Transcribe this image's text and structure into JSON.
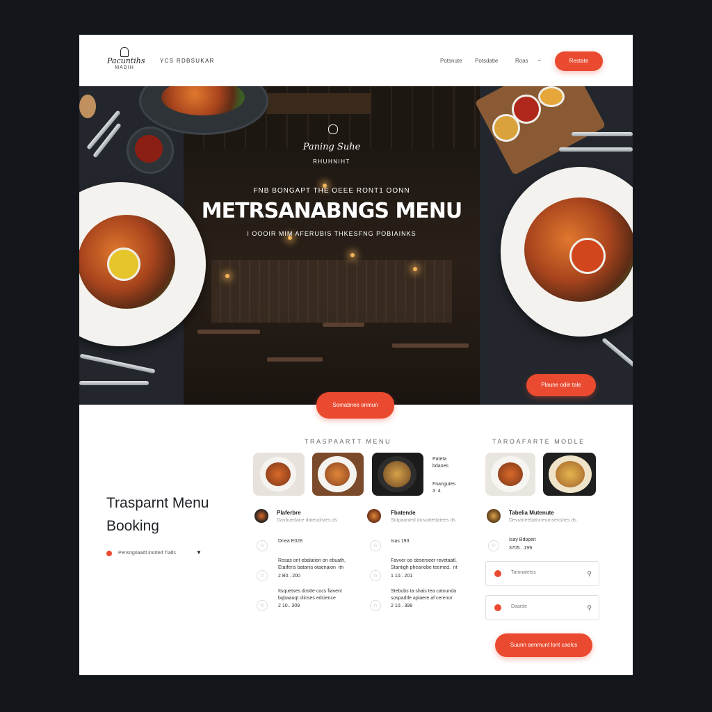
{
  "header": {
    "logo_script": "Pacuntihs",
    "logo_sub": "MADIH",
    "tagline": "YCS RDBSUKAR",
    "nav": [
      "Potsnute",
      "Potsdatie",
      "Roas"
    ],
    "cta": "Restate"
  },
  "hero": {
    "logo_script": "Paning Suhe",
    "logo_sub": "RHUHNIHT",
    "pretitle": "FNB BONGAPT THE OEEE RONT1 OONN",
    "title": "METRSANABNGS MENU",
    "subtitle": "I OOOIR MIM AFERUBIS THKESFNG POBIAINKS",
    "right_button": "Plaune odin tale",
    "center_button": "Semabnee onmun"
  },
  "booking": {
    "heading_line1": "Traspar­nt Menu",
    "heading_line2": "Booking",
    "dropdown_text": "Pensngoaadt inorted Tiatls"
  },
  "menu_section": {
    "label": "TRASPAARTT MENU",
    "side_text1": "Pateta\nbdanes",
    "side_text2": "Fnangutes\n3  4",
    "columns": [
      {
        "name": "Plaferbre",
        "desc": "Davbuedane dateoolstes ds",
        "price_line": "Dnea  E028",
        "item1_desc": "Rosas ont ebalation on ebuath,\nEtatferis batanis otaenaion  itn",
        "item1_price": "2 B0..  200",
        "item2_desc": "Itsquetses dostte cocs fiavent\nbqbaauqt olinses edcience",
        "item2_price": "2 10..  309"
      },
      {
        "name": "Fbatende",
        "desc": "Sotpaanted dusuatettatees  ds",
        "price_line": "Isas  193",
        "item1_desc": "Favver oo deserseer revetaatl,\nStantigh pheariobe teemed.  nt",
        "item1_price": "1 10..  201",
        "item2_desc": "Stebubs ta shais tea catounda\nsospadtle aplaere af cerenor",
        "item2_price": "2 10..  399"
      }
    ]
  },
  "table_section": {
    "label": "TAROAFARTE MODLE",
    "name": "Tabelia Mutenute",
    "desc": "Devraneebatoneomsenshes  ds",
    "price_label": "Isay  Bdopeit",
    "price_range": "3705  ..199",
    "field1": "Tamnatetss",
    "field2": "Daarde",
    "cta": "Suunn aenmunt lont caolcs"
  }
}
